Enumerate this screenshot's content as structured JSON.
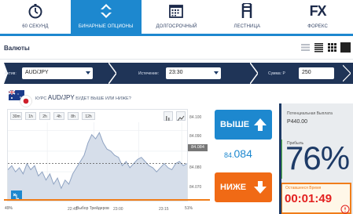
{
  "nav": {
    "items": [
      {
        "label": "60 СЕКУНД",
        "icon": "stopwatch-icon"
      },
      {
        "label": "БИНАРНЫЕ ОПЦИОНЫ",
        "icon": "up-down-arrows-icon"
      },
      {
        "label": "ДОЛГОСРОЧНЫЙ",
        "icon": "calendar-icon"
      },
      {
        "label": "ЛЕСТНИЦА",
        "icon": "ladder-icon"
      },
      {
        "label": "ФОРЕКС",
        "icon": "fx-logo-icon"
      }
    ],
    "fx_logo": "FX",
    "active_index": 1
  },
  "subbar": {
    "title": "Валюты",
    "view_icons": [
      "list-view-icon",
      "compact-list-icon",
      "grid-small-icon",
      "grid-large-icon"
    ]
  },
  "filter": {
    "asset_label": "Актив:",
    "asset_value": "AUD/JPY",
    "expiry_label": "Истечение:",
    "expiry_value": "23:30",
    "amount_label": "Сумма: Р",
    "amount_value": "250"
  },
  "chart": {
    "question_prefix": "КУРС",
    "pair": "AUD/JPY",
    "question_suffix": "БУДЕТ ВЫШЕ ИЛИ НИЖЕ?",
    "timeframes": [
      "30m",
      "1h",
      "2h",
      "4h",
      "8h",
      "12h"
    ],
    "current_price_tag": "84.084",
    "x_ticks": [
      "22:45",
      "23:00",
      "23:15"
    ],
    "y_ticks": [
      "84.100",
      "84.090",
      "84.080",
      "84.070"
    ]
  },
  "chart_data": {
    "type": "area",
    "x_ticks": [
      "22:45",
      "23:00",
      "23:15"
    ],
    "y_ticks": [
      84.1,
      84.09,
      84.08,
      84.07
    ],
    "ylim": [
      84.066,
      84.104
    ],
    "current_price": 84.084,
    "series": [
      {
        "values": [
          84.081,
          84.083,
          84.08,
          84.082,
          84.079,
          84.084,
          84.081,
          84.083,
          84.078,
          84.08,
          84.076,
          84.079,
          84.074,
          84.077,
          84.072,
          84.076,
          84.074,
          84.079,
          84.082,
          84.085,
          84.088,
          84.094,
          84.098,
          84.096,
          84.099,
          84.094,
          84.091,
          84.09,
          84.088,
          84.087,
          84.083,
          84.085,
          84.082,
          84.084,
          84.086,
          84.087,
          84.085,
          84.083,
          84.082,
          84.08,
          84.082,
          84.084,
          84.082,
          84.081,
          84.084,
          84.085,
          84.083,
          84.084
        ]
      }
    ]
  },
  "buttons": {
    "up_label": "ВЫШЕ",
    "down_label": "НИЖЕ"
  },
  "price": {
    "main": "84.",
    "decimals": "084"
  },
  "traders": {
    "left_pct": "49%",
    "label": "Выбор Трейдеров",
    "right_pct": "51%"
  },
  "payout": {
    "potential_label": "Потенциальная Выплата",
    "potential_amount": "Р440.00",
    "profit_label": "Прибыль",
    "profit_pct": "76%"
  },
  "timer": {
    "label": "Оставшееся Время",
    "value": "00:01:49"
  },
  "colors": {
    "accent_blue": "#1d88cf",
    "navy": "#1f3457",
    "orange": "#f06a15",
    "red_timer": "#e3201f",
    "green": "#5fc24b"
  }
}
